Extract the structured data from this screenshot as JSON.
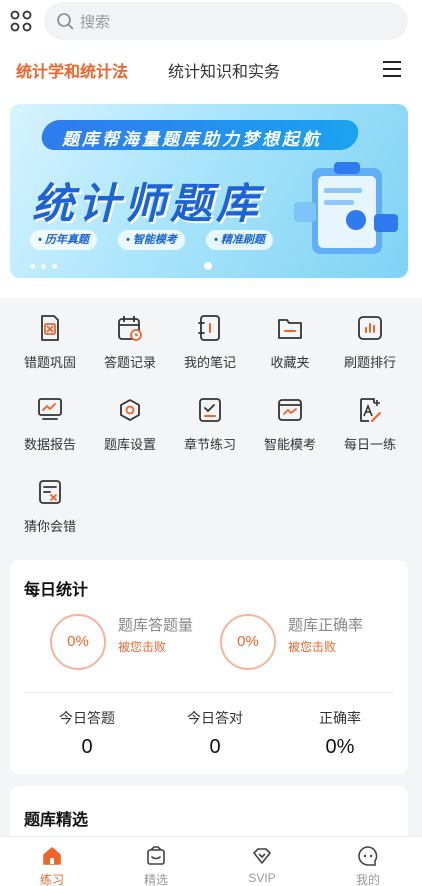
{
  "search": {
    "placeholder": "搜索"
  },
  "tabs": [
    {
      "label": "统计学和统计法",
      "active": true
    },
    {
      "label": "统计知识和实务",
      "active": false
    }
  ],
  "banner": {
    "headline": "题库帮海量题库助力梦想起航",
    "title": "统计师题库",
    "chips": [
      "• 历年真题",
      "• 智能模考",
      "• 精准刷题"
    ]
  },
  "menu": [
    {
      "label": "错题巩固",
      "icon": "wrong-question-icon"
    },
    {
      "label": "答题记录",
      "icon": "calendar-clock-icon"
    },
    {
      "label": "我的笔记",
      "icon": "notebook-icon"
    },
    {
      "label": "收藏夹",
      "icon": "folder-icon"
    },
    {
      "label": "刷题排行",
      "icon": "ranking-chart-icon"
    },
    {
      "label": "数据报告",
      "icon": "monitor-chart-icon"
    },
    {
      "label": "题库设置",
      "icon": "settings-icon"
    },
    {
      "label": "章节练习",
      "icon": "chapter-check-icon"
    },
    {
      "label": "智能模考",
      "icon": "smart-exam-icon"
    },
    {
      "label": "每日一练",
      "icon": "daily-practice-icon"
    },
    {
      "label": "猜你会错",
      "icon": "guess-wrong-icon"
    }
  ],
  "daily_stats": {
    "title": "每日统计",
    "volume": {
      "percent": "0%",
      "label": "题库答题量",
      "sub": "被您击败"
    },
    "accuracy": {
      "percent": "0%",
      "label": "题库正确率",
      "sub": "被您击败"
    },
    "columns": [
      {
        "label": "今日答题",
        "value": "0"
      },
      {
        "label": "今日答对",
        "value": "0"
      },
      {
        "label": "正确率",
        "value": "0%"
      }
    ]
  },
  "picks": {
    "title": "题库精选"
  },
  "nav": [
    {
      "label": "练习",
      "icon": "home-icon",
      "active": true
    },
    {
      "label": "精选",
      "icon": "featured-icon",
      "active": false
    },
    {
      "label": "SVIP",
      "icon": "diamond-icon",
      "active": false
    },
    {
      "label": "我的",
      "icon": "profile-chat-icon",
      "active": false
    }
  ],
  "colors": {
    "accent": "#f0642a",
    "banner_blue": "#1c63d6"
  }
}
